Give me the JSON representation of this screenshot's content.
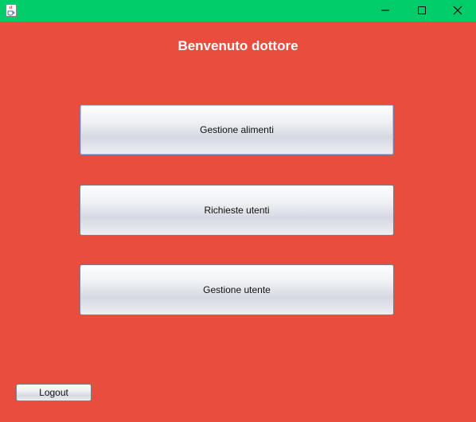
{
  "window": {
    "titlebar_color": "#00cc6a",
    "background_color": "#e84d3d",
    "app_icon": "java-cup-icon",
    "controls": [
      "minimize-icon",
      "maximize-icon",
      "close-icon"
    ]
  },
  "header": {
    "title": "Benvenuto dottore"
  },
  "menu": {
    "buttons": [
      {
        "label": "Gestione alimenti",
        "focused": true
      },
      {
        "label": "Richieste utenti",
        "focused": false
      },
      {
        "label": "Gestione utente",
        "focused": false
      }
    ]
  },
  "footer": {
    "logout_label": "Logout"
  }
}
